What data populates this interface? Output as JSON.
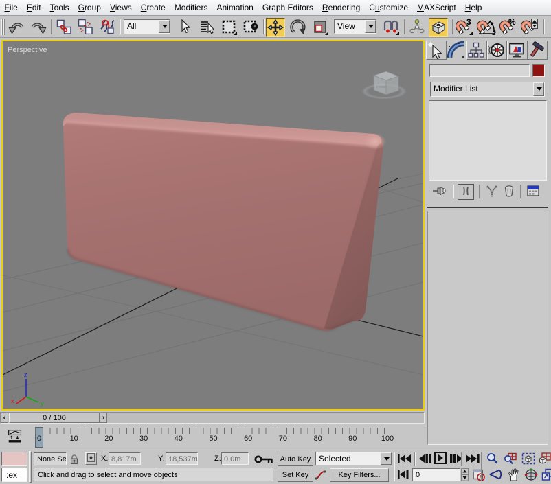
{
  "app": {
    "name": "3ds Max"
  },
  "menu_bar": {
    "items": [
      {
        "label": "File",
        "underline": 0
      },
      {
        "label": "Edit",
        "underline": 0
      },
      {
        "label": "Tools",
        "underline": 0
      },
      {
        "label": "Group",
        "underline": 0
      },
      {
        "label": "Views",
        "underline": 0
      },
      {
        "label": "Create",
        "underline": 0
      },
      {
        "label": "Modifiers",
        "underline": -1
      },
      {
        "label": "Animation",
        "underline": -1
      },
      {
        "label": "Graph Editors",
        "underline": -1
      },
      {
        "label": "Rendering",
        "underline": 0
      },
      {
        "label": "Customize",
        "underline": 1
      },
      {
        "label": "MAXScript",
        "underline": 0
      },
      {
        "label": "Help",
        "underline": 0
      }
    ]
  },
  "toolbar": {
    "selection_filter_value": "All",
    "coord_system_value": "View",
    "icons": [
      "undo",
      "redo",
      "select-and-link",
      "unlink-selection",
      "bind-to-space-warp",
      "select-object",
      "select-by-name",
      "rectangular-selection-region",
      "window-crossing",
      "select-and-move",
      "select-and-rotate",
      "select-and-uniform-scale",
      "use-pivot-point-center",
      "select-and-manipulate",
      "keyboard-shortcut-override-toggle",
      "snaps-toggle-3d",
      "angle-snap-toggle",
      "percent-snap-toggle",
      "spinner-snap-toggle"
    ],
    "active_buttons": [
      "select-and-move",
      "keyboard-shortcut-override-toggle"
    ],
    "highlight_color": "#f2cd55"
  },
  "viewport": {
    "label": "Perspective",
    "background": "#7d7d7d",
    "active_border_color": "#efce05",
    "object_color": "#a87371",
    "axis_labels": {
      "x": "x",
      "y": "y",
      "z": "z"
    }
  },
  "command_panel": {
    "tabs": [
      "create",
      "modify",
      "hierarchy",
      "motion",
      "display",
      "utilities"
    ],
    "active_tab": "modify",
    "name_field_value": "",
    "color_swatch": "#8e1414",
    "modifier_list_label": "Modifier List",
    "stack_buttons": [
      "pin-stack",
      "show-end-result",
      "make-unique",
      "remove-modifier",
      "configure-modifier-sets"
    ]
  },
  "time_slider": {
    "value": "0 / 100",
    "left_arrow": "‹",
    "right_arrow": "›"
  },
  "track_bar": {
    "labels": [
      "0",
      "10",
      "20",
      "30",
      "40",
      "50",
      "60",
      "70",
      "80",
      "90",
      "100"
    ],
    "current_frame": "0"
  },
  "status_bar": {
    "mini_listener_text": ":ex",
    "selection_status": "None Se",
    "x_label": "X:",
    "x_value": "8,817m",
    "y_label": "Y:",
    "y_value": "18,537m",
    "z_label": "Z:",
    "z_value": "0,0m",
    "prompt": "Click and drag to select and move objects"
  },
  "animation_controls": {
    "auto_key_label": "Auto Key",
    "set_key_label": "Set Key",
    "key_mode_value": "Selected",
    "key_filters_label": "Key Filters...",
    "frame_field_value": "0"
  }
}
